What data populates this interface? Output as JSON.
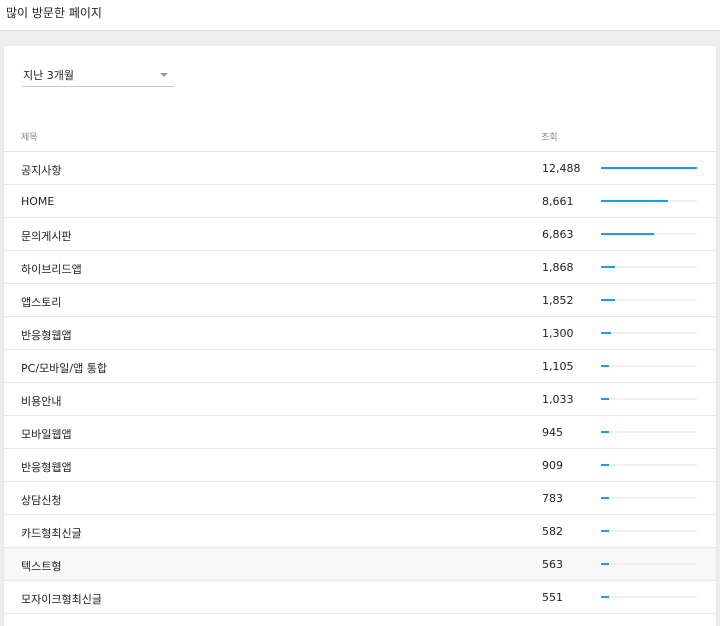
{
  "header": {
    "title": "많이 방문한 페이지"
  },
  "filter": {
    "period": "지난 3개월"
  },
  "table": {
    "columns": {
      "title": "제목",
      "views": "조회"
    },
    "rows": [
      {
        "title": "공지사항",
        "views": "12,488",
        "share": 1.0
      },
      {
        "title": "HOME",
        "views": "8,661",
        "share": 0.694
      },
      {
        "title": "문의게시판",
        "views": "6,863",
        "share": 0.55
      },
      {
        "title": "하이브리드앱",
        "views": "1,868",
        "share": 0.15
      },
      {
        "title": "앱스토리",
        "views": "1,852",
        "share": 0.148
      },
      {
        "title": "반응형웹앱",
        "views": "1,300",
        "share": 0.104
      },
      {
        "title": "PC/모바일/앱 통합",
        "views": "1,105",
        "share": 0.088
      },
      {
        "title": "비용안내",
        "views": "1,033",
        "share": 0.083
      },
      {
        "title": "모바일웹앱",
        "views": "945",
        "share": 0.076
      },
      {
        "title": "반응형웹앱",
        "views": "909",
        "share": 0.073
      },
      {
        "title": "상담신청",
        "views": "783",
        "share": 0.063
      },
      {
        "title": "카드형최신글",
        "views": "582",
        "share": 0.047
      },
      {
        "title": "텍스트형",
        "views": "563",
        "share": 0.045,
        "highlighted": true
      },
      {
        "title": "모자이크형최신글",
        "views": "551",
        "share": 0.044
      }
    ]
  },
  "colors": {
    "bar": "#1a9ee0",
    "track": "#f0f0f0"
  }
}
